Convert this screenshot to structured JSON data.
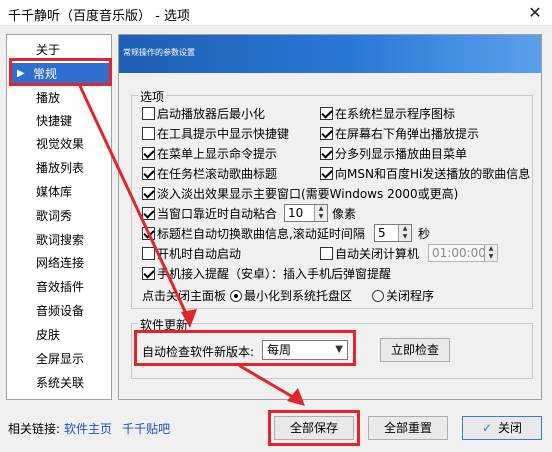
{
  "window": {
    "title": "千千静听（百度音乐版） - 选项",
    "close_glyph": "✕"
  },
  "sidebar": {
    "items": [
      {
        "label": "关于"
      },
      {
        "label": "常规",
        "selected": true
      },
      {
        "label": "播放"
      },
      {
        "label": "快捷键"
      },
      {
        "label": "视觉效果"
      },
      {
        "label": "播放列表"
      },
      {
        "label": "媒体库"
      },
      {
        "label": "歌词秀"
      },
      {
        "label": "歌词搜索"
      },
      {
        "label": "网络连接"
      },
      {
        "label": "音效插件"
      },
      {
        "label": "音频设备"
      },
      {
        "label": "皮肤"
      },
      {
        "label": "全屏显示"
      },
      {
        "label": "系统关联"
      }
    ]
  },
  "panel": {
    "header_title": "常规操作的参数设置",
    "options_group": {
      "legend": "选项",
      "checks": [
        {
          "label": "启动播放器后最小化",
          "checked": false
        },
        {
          "label": "在系统栏显示程序图标",
          "checked": true
        },
        {
          "label": "在工具提示中显示快捷键",
          "checked": false
        },
        {
          "label": "在屏幕右下角弹出播放提示",
          "checked": true
        },
        {
          "label": "在菜单上显示命令提示",
          "checked": true
        },
        {
          "label": "分多列显示播放曲目菜单",
          "checked": true
        },
        {
          "label": "在任务栏滚动歌曲标题",
          "checked": true
        },
        {
          "label": "向MSN和百度Hi发送播放的歌曲信息",
          "checked": true
        },
        {
          "label": "淡入淡出效果显示主要窗口(需要Windows 2000或更高)",
          "checked": true
        },
        {
          "label": "当窗口靠近时自动粘合",
          "checked": true
        },
        {
          "label": "标题栏自动切换歌曲信息,滚动延时间隔",
          "checked": true
        },
        {
          "label": "开机时自动启动",
          "checked": false
        },
        {
          "label": "自动关闭计算机",
          "checked": false
        },
        {
          "label": "手机接入提醒（安卓）：插入手机后弹窗提醒",
          "checked": true
        }
      ],
      "snap_value": "10",
      "snap_unit": "像素",
      "scroll_value": "5",
      "scroll_unit": "秒",
      "shutdown_time": "01:00:00",
      "close_label": "点击关闭主面板",
      "radios": [
        {
          "label": "最小化到系统托盘区",
          "checked": true
        },
        {
          "label": "关闭程序",
          "checked": false
        }
      ]
    },
    "update_group": {
      "legend": "软件更新",
      "check_label": "自动检查软件新版本:",
      "frequency": "每周",
      "check_now": "立即检查"
    }
  },
  "footer": {
    "related_label": "相关链接:",
    "links": [
      "软件主页",
      "千千贴吧"
    ],
    "buttons": {
      "save_all": "全部保存",
      "reset_all": "全部重置",
      "close": "关闭"
    }
  },
  "colors": {
    "selection": "#2f6fd0",
    "highlight": "#e0262c",
    "link": "#1a4fbf"
  }
}
